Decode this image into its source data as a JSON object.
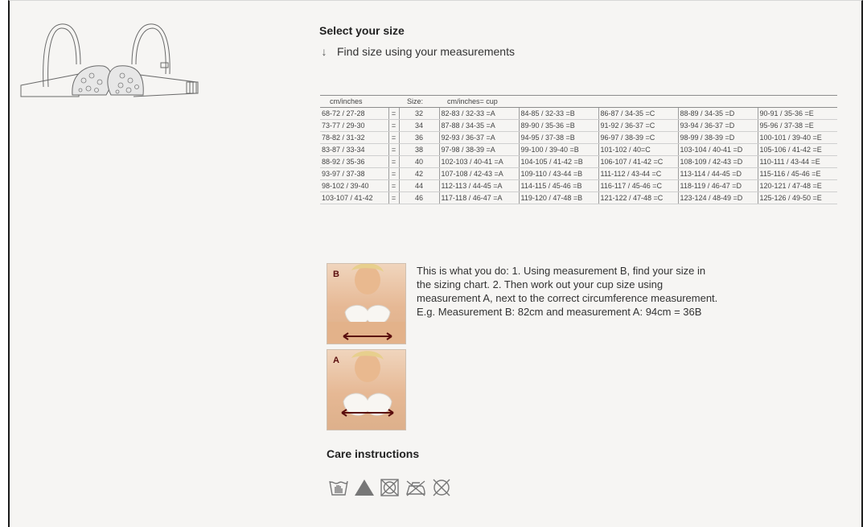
{
  "size_section": {
    "title": "Select your size",
    "find_size_label": "Find size using your measurements",
    "find_size_icon": "arrow-down-icon"
  },
  "size_table": {
    "headers": {
      "col1": "cm/inches",
      "col3": "Size:",
      "col4": "cm/inches= cup"
    },
    "rows": [
      {
        "underbust": "68-72 / 27-28",
        "eq": "=",
        "size": "32",
        "cups": [
          "82-83 / 32-33 =A",
          "84-85 / 32-33 =B",
          "86-87 / 34-35 =C",
          "88-89 / 34-35 =D",
          "90-91 / 35-36 =E"
        ]
      },
      {
        "underbust": "73-77 / 29-30",
        "eq": "=",
        "size": "34",
        "cups": [
          "87-88 / 34-35 =A",
          "89-90 / 35-36 =B",
          "91-92 / 36-37 =C",
          "93-94 / 36-37 =D",
          "95-96 / 37-38 =E"
        ]
      },
      {
        "underbust": "78-82 / 31-32",
        "eq": "=",
        "size": "36",
        "cups": [
          "92-93 / 36-37 =A",
          "94-95 / 37-38 =B",
          "96-97 / 38-39 =C",
          "98-99 / 38-39 =D",
          "100-101 / 39-40 =E"
        ]
      },
      {
        "underbust": "83-87 / 33-34",
        "eq": "=",
        "size": "38",
        "cups": [
          "97-98 / 38-39 =A",
          "99-100 / 39-40 =B",
          "101-102 / 40=C",
          "103-104 / 40-41 =D",
          "105-106 / 41-42 =E"
        ]
      },
      {
        "underbust": "88-92 / 35-36",
        "eq": "=",
        "size": "40",
        "cups": [
          "102-103 / 40-41 =A",
          "104-105 / 41-42 =B",
          "106-107 / 41-42 =C",
          "108-109 / 42-43 =D",
          "110-111 / 43-44 =E"
        ]
      },
      {
        "underbust": "93-97 / 37-38",
        "eq": "=",
        "size": "42",
        "cups": [
          "107-108 / 42-43 =A",
          "109-110 / 43-44 =B",
          "111-112 / 43-44 =C",
          "113-114 / 44-45 =D",
          "115-116 / 45-46 =E"
        ]
      },
      {
        "underbust": "98-102 / 39-40",
        "eq": "=",
        "size": "44",
        "cups": [
          "112-113 / 44-45 =A",
          "114-115 / 45-46 =B",
          "116-117 / 45-46 =C",
          "118-119 / 46-47 =D",
          "120-121 / 47-48 =E"
        ]
      },
      {
        "underbust": "103-107 / 41-42",
        "eq": "=",
        "size": "46",
        "cups": [
          "117-118 / 46-47 =A",
          "119-120 / 47-48 =B",
          "121-122 / 47-48 =C",
          "123-124 / 48-49 =D",
          "125-126 / 49-50 =E"
        ]
      }
    ]
  },
  "measurement": {
    "photo_b_label": "B",
    "photo_a_label": "A",
    "instructions": "This is what you do: 1. Using measurement B, find your size in the sizing chart. 2. Then work out your cup size using measurement A, next to the correct circumference measurement. E.g. Measurement B: 82cm and measurement A: 94cm = 36B"
  },
  "care": {
    "title": "Care instructions",
    "icons": [
      "hand-wash-icon",
      "bleach-icon",
      "no-tumble-dry-icon",
      "no-iron-icon",
      "no-dry-clean-icon"
    ]
  },
  "colors": {
    "background": "#f6f5f3",
    "arrow_accent": "#5a0d0d"
  }
}
